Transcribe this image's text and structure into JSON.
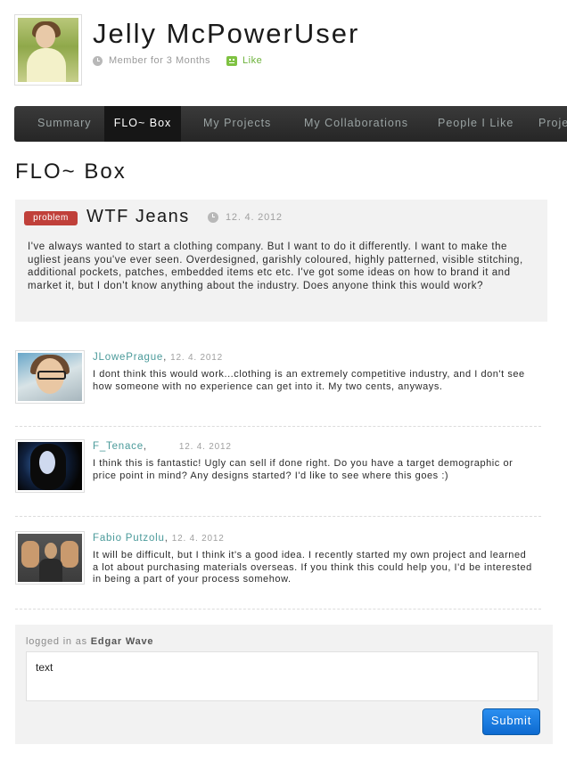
{
  "profile": {
    "name": "Jelly McPowerUser",
    "member_since": "Member for 3 Months",
    "like_label": "Like"
  },
  "nav": {
    "tabs": [
      {
        "label": "Summary",
        "active": false
      },
      {
        "label": "FLO~ Box",
        "active": true
      },
      {
        "label": "My Projects",
        "active": false
      },
      {
        "label": "My Collaborations",
        "active": false
      },
      {
        "label": "People I Like",
        "active": false
      },
      {
        "label": "Proje",
        "active": false
      }
    ]
  },
  "page": {
    "title": "FLO~ Box"
  },
  "post": {
    "badge": "problem",
    "title": "WTF Jeans",
    "date": "12. 4. 2012",
    "body": "I've always wanted to start a clothing company. But I want to do it differently. I want to make the ugliest jeans you've ever seen. Overdesigned, garishly coloured, highly patterned, visible stitching, additional pockets, patches, embedded items etc etc. I've got some ideas on how to brand it and market it, but I don't know anything about the industry. Does anyone think this would work?"
  },
  "comments": [
    {
      "author": "JLowePrague",
      "date": "12. 4. 2012",
      "body": "I dont think this would work...clothing is an extremely competitive industry, and I don't see how someone with no experience can get into it. My two cents, anyways."
    },
    {
      "author": "F_Tenace",
      "date": "12. 4. 2012",
      "body": "I think this is fantastic! Ugly can sell if done right. Do you have a target demographic or price point in mind? Any designs started? I'd like to see where this goes :)"
    },
    {
      "author": "Fabio Putzolu",
      "date": "12. 4. 2012",
      "body": "It will be difficult, but I think it's a good idea. I recently started my own project and learned a lot about purchasing materials overseas. If you think this could help you, I'd be interested in being a part of your process somehow."
    }
  ],
  "reply": {
    "logged_in_prefix": "logged in as",
    "user": "Edgar Wave",
    "input_value": "text",
    "submit_label": "Submit"
  },
  "colors": {
    "accent_teal": "#4a9a9a",
    "like_green": "#6cb23a",
    "badge_red": "#c0403a",
    "submit_blue": "#0d6ad0",
    "nav_bg": "#262626"
  },
  "icons": {
    "clock": "clock-icon",
    "like": "like-icon"
  }
}
